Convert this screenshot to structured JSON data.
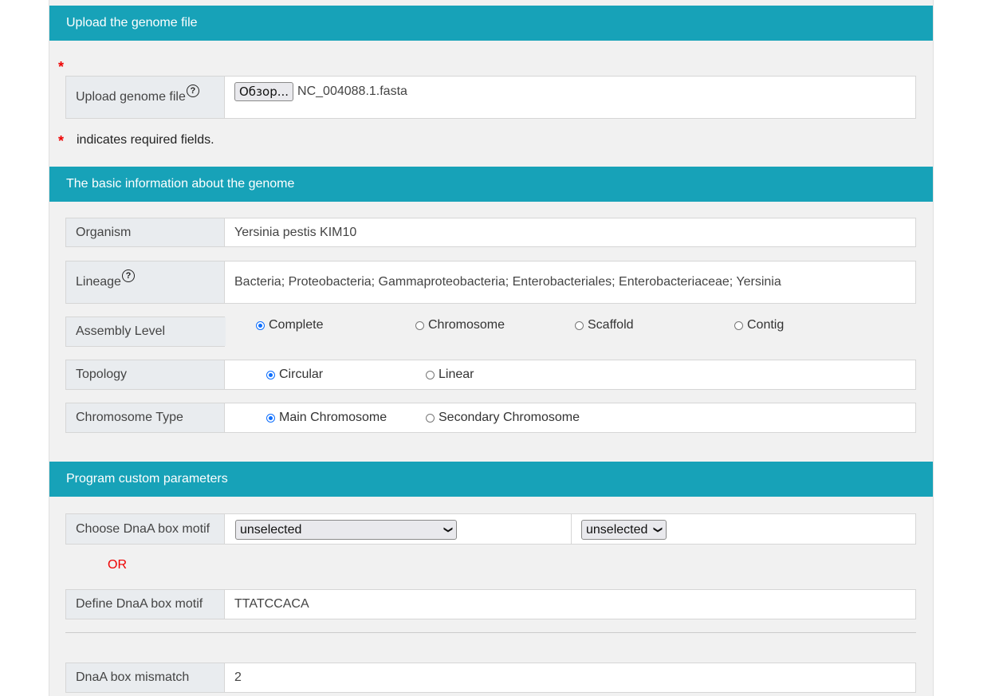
{
  "upload_section": {
    "header": "Upload the genome file",
    "field_label": "Upload genome file",
    "help": "?",
    "browse_button": "Обзор...",
    "file_name": "NC_004088.1.fasta",
    "required_marker": "*",
    "required_note": "indicates required fields."
  },
  "basic_section": {
    "header": "The basic information about the genome",
    "organism_label": "Organism",
    "organism_value": "Yersinia pestis KIM10",
    "lineage_label": "Lineage",
    "lineage_help": "?",
    "lineage_value": "Bacteria; Proteobacteria; Gammaproteobacteria; Enterobacteriales; Enterobacteriaceae; Yersinia",
    "assembly_label": "Assembly Level",
    "assembly_options": [
      "Complete",
      "Chromosome",
      "Scaffold",
      "Contig"
    ],
    "assembly_selected": "Complete",
    "topology_label": "Topology",
    "topology_options": [
      "Circular",
      "Linear"
    ],
    "topology_selected": "Circular",
    "chromosome_type_label": "Chromosome Type",
    "chromosome_type_options": [
      "Main Chromosome",
      "Secondary Chromosome"
    ],
    "chromosome_type_selected": "Main Chromosome"
  },
  "program_section": {
    "header": "Program custom parameters",
    "choose_motif_label": "Choose DnaA box motif",
    "choose_motif_select1": "unselected",
    "choose_motif_select2": "unselected",
    "or_text": "OR",
    "define_motif_label": "Define DnaA box motif",
    "define_motif_value": "TTATCCACA",
    "mismatch_label": "DnaA box mismatch",
    "mismatch_value": "2"
  },
  "colors": {
    "header_bg": "#17a2b8",
    "required": "#ee0000",
    "radio_checked": "#0d6efd"
  }
}
